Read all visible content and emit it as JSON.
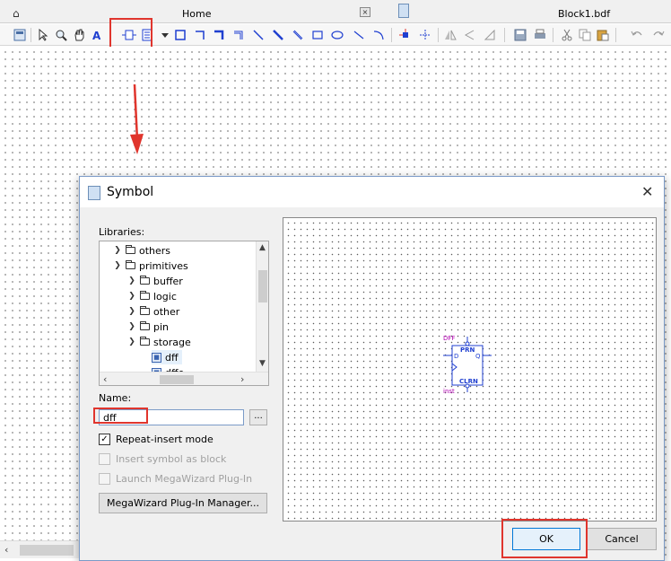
{
  "tabs": {
    "home_label": "Home",
    "file_label": "Block1.bdf"
  },
  "toolbar": {
    "icons": [
      "select-tool-icon",
      "zoom-icon",
      "pan-hand-icon",
      "text-tool-icon",
      "symbol-tool-icon",
      "block-tool-icon",
      "pin-tool-icon",
      "orthogonal-node-icon",
      "orthogonal-bus-icon",
      "orthogonal-conduit-icon",
      "diagonal-node-icon",
      "diagonal-bus-icon",
      "diagonal-conduit-icon",
      "rectangle-icon",
      "ellipse-icon",
      "line-icon",
      "arc-icon",
      "assign-pins-icon",
      "partial-line-icon",
      "flip-horizontal-icon",
      "flip-vertical-icon",
      "rotate-icon",
      "save-icon",
      "print-icon",
      "cut-icon",
      "copy-icon",
      "paste-icon",
      "undo-icon",
      "redo-icon"
    ]
  },
  "dialog": {
    "title": "Symbol",
    "libraries_label": "Libraries:",
    "tree": [
      {
        "label": "others",
        "expanded": false,
        "type": "folder"
      },
      {
        "label": "primitives",
        "expanded": true,
        "type": "folder"
      },
      {
        "label": "buffer",
        "expanded": false,
        "type": "folder"
      },
      {
        "label": "logic",
        "expanded": false,
        "type": "folder"
      },
      {
        "label": "other",
        "expanded": false,
        "type": "folder"
      },
      {
        "label": "pin",
        "expanded": false,
        "type": "folder"
      },
      {
        "label": "storage",
        "expanded": true,
        "type": "folder"
      },
      {
        "label": "dff",
        "type": "symbol",
        "selected": true
      },
      {
        "label": "dffe",
        "type": "symbol"
      }
    ],
    "name_label": "Name:",
    "name_value": "dff",
    "browse_label": "...",
    "repeat_insert_label": "Repeat-insert mode",
    "repeat_insert_checked": true,
    "insert_block_label": "Insert symbol as block",
    "launch_megawizard_label": "Launch MegaWizard Plug-In",
    "megawizard_button_label": "MegaWizard Plug-In Manager...",
    "ok_label": "OK",
    "cancel_label": "Cancel"
  },
  "symbol_preview": {
    "name": "DFF",
    "instance": "inst",
    "pin_pre": "PRN",
    "pin_d": "D",
    "pin_q": "Q",
    "pin_clr": "CLRN"
  },
  "colors": {
    "highlight": "#e0352d",
    "symbol_blue": "#1f3fd0",
    "symbol_label": "#b000b0",
    "ok_border": "#0078d7"
  }
}
